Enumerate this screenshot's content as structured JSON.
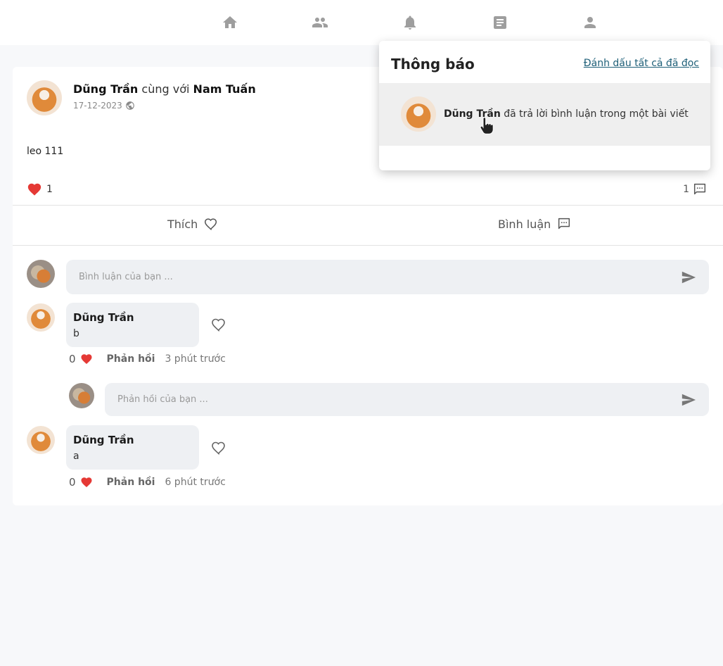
{
  "nav": {
    "icons": [
      "home-icon",
      "friends-icon",
      "bell-icon",
      "posts-icon",
      "profile-icon"
    ]
  },
  "post": {
    "author": "Dũng Trần",
    "with_text": "cùng với",
    "tagged": "Nam Tuấn",
    "date": "17-12-2023",
    "content": "leo 111",
    "like_count": "1",
    "comment_count": "1",
    "like_label": "Thích",
    "comment_label": "Bình luận"
  },
  "comment_box": {
    "placeholder": "Bình luận của bạn ..."
  },
  "comments": [
    {
      "name": "Dũng Trần",
      "text": "b",
      "likes": "0",
      "reply_label": "Phản hồi",
      "time": "3 phút trước"
    },
    {
      "name": "Dũng Trần",
      "text": "a",
      "likes": "0",
      "reply_label": "Phản hồi",
      "time": "6 phút trước"
    }
  ],
  "reply_box": {
    "placeholder": "Phản hồi của bạn ..."
  },
  "notifications": {
    "title": "Thông báo",
    "mark_all": "Đánh dấu tất cả đã đọc",
    "items": [
      {
        "actor": "Dũng Trần",
        "message": "đã trả lời bình luận trong một bài viết"
      }
    ]
  },
  "colors": {
    "accent_link": "#1e5f78",
    "like_red": "#e53935",
    "bubble_bg": "#eef0f3"
  }
}
